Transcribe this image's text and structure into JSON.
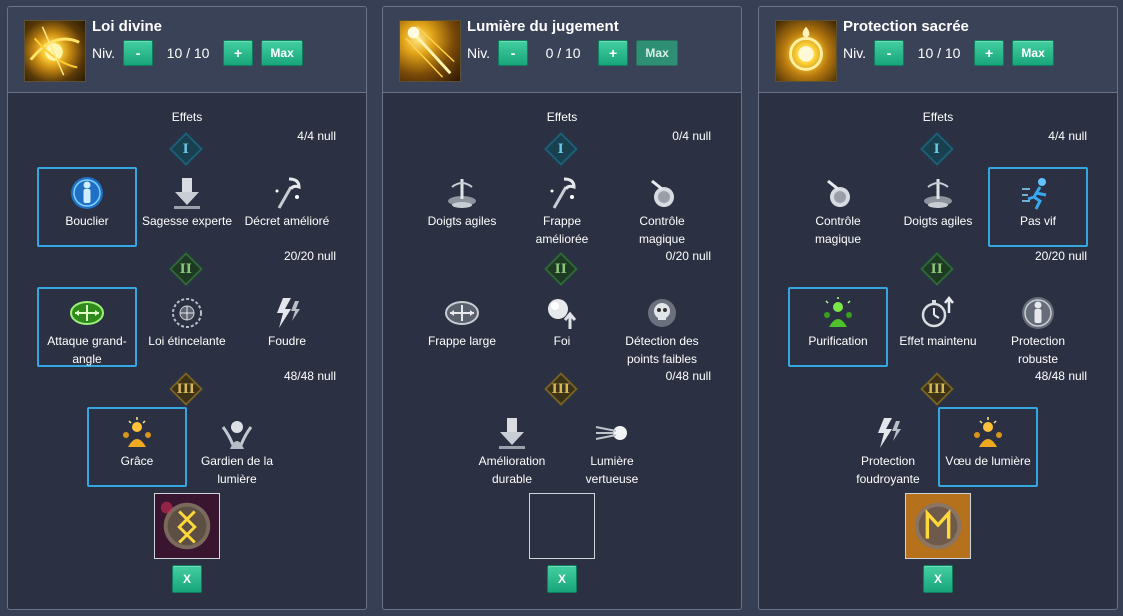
{
  "panels": [
    {
      "title": "Loi divine",
      "level_label": "Niv.",
      "level_value": "10 / 10",
      "minus": "-",
      "plus": "+",
      "max": "Max",
      "effects_title": "Effets",
      "tier_counts": [
        "4/4 null",
        "20/20 null",
        "48/48 null"
      ],
      "tiers": [
        "I",
        "II",
        "III"
      ],
      "effects": [
        {
          "label": "Bouclier",
          "icon": "shield-person-icon"
        },
        {
          "label": "Sagesse experte",
          "icon": "down-arrow-icon"
        },
        {
          "label": "Décret amélioré",
          "icon": "staff-icon"
        },
        {
          "label": "Attaque grand-angle",
          "icon": "wide-attack-icon"
        },
        {
          "label": "Loi étincelante",
          "icon": "sparkle-wheel-icon"
        },
        {
          "label": "Foudre",
          "icon": "lightning-icon"
        },
        {
          "label": "Grâce",
          "icon": "grace-icon"
        },
        {
          "label": "Gardien de la lumière",
          "icon": "guardian-icon"
        }
      ],
      "close": "X"
    },
    {
      "title": "Lumière du jugement",
      "level_label": "Niv.",
      "level_value": "0 / 10",
      "minus": "-",
      "plus": "+",
      "max": "Max",
      "effects_title": "Effets",
      "tier_counts": [
        "0/4 null",
        "0/20 null",
        "0/48 null"
      ],
      "tiers": [
        "I",
        "II",
        "III"
      ],
      "effects": [
        {
          "label": "Doigts agiles",
          "icon": "fountain-icon"
        },
        {
          "label": "Frappe améliorée",
          "icon": "staff-icon"
        },
        {
          "label": "Contrôle magique",
          "icon": "potion-icon"
        },
        {
          "label": "Frappe large",
          "icon": "wide-attack-icon"
        },
        {
          "label": "Foi",
          "icon": "orb-up-icon"
        },
        {
          "label": "Détection des points faibles",
          "icon": "skull-icon"
        },
        {
          "label": "Amélioration durable",
          "icon": "down-arrow-icon"
        },
        {
          "label": "Lumière vertueuse",
          "icon": "comet-icon"
        }
      ],
      "close": "X"
    },
    {
      "title": "Protection sacrée",
      "level_label": "Niv.",
      "level_value": "10 / 10",
      "minus": "-",
      "plus": "+",
      "max": "Max",
      "effects_title": "Effets",
      "tier_counts": [
        "4/4 null",
        "20/20 null",
        "48/48 null"
      ],
      "tiers": [
        "I",
        "II",
        "III"
      ],
      "effects": [
        {
          "label": "Contrôle magique",
          "icon": "potion-icon"
        },
        {
          "label": "Doigts agiles",
          "icon": "fountain-icon"
        },
        {
          "label": "Pas vif",
          "icon": "running-icon"
        },
        {
          "label": "Purification",
          "icon": "purification-icon"
        },
        {
          "label": "Effet maintenu",
          "icon": "stopwatch-icon"
        },
        {
          "label": "Protection robuste",
          "icon": "shield-person-icon"
        },
        {
          "label": "Protection foudroyante",
          "icon": "lightning-icon"
        },
        {
          "label": "Vœu de lumière",
          "icon": "grace-icon"
        }
      ],
      "close": "X"
    }
  ],
  "colors": {
    "accent_green": "#17a57a",
    "select_blue": "#34a6e0",
    "panel_bg": "#2b3142",
    "page_bg": "#373f55"
  }
}
